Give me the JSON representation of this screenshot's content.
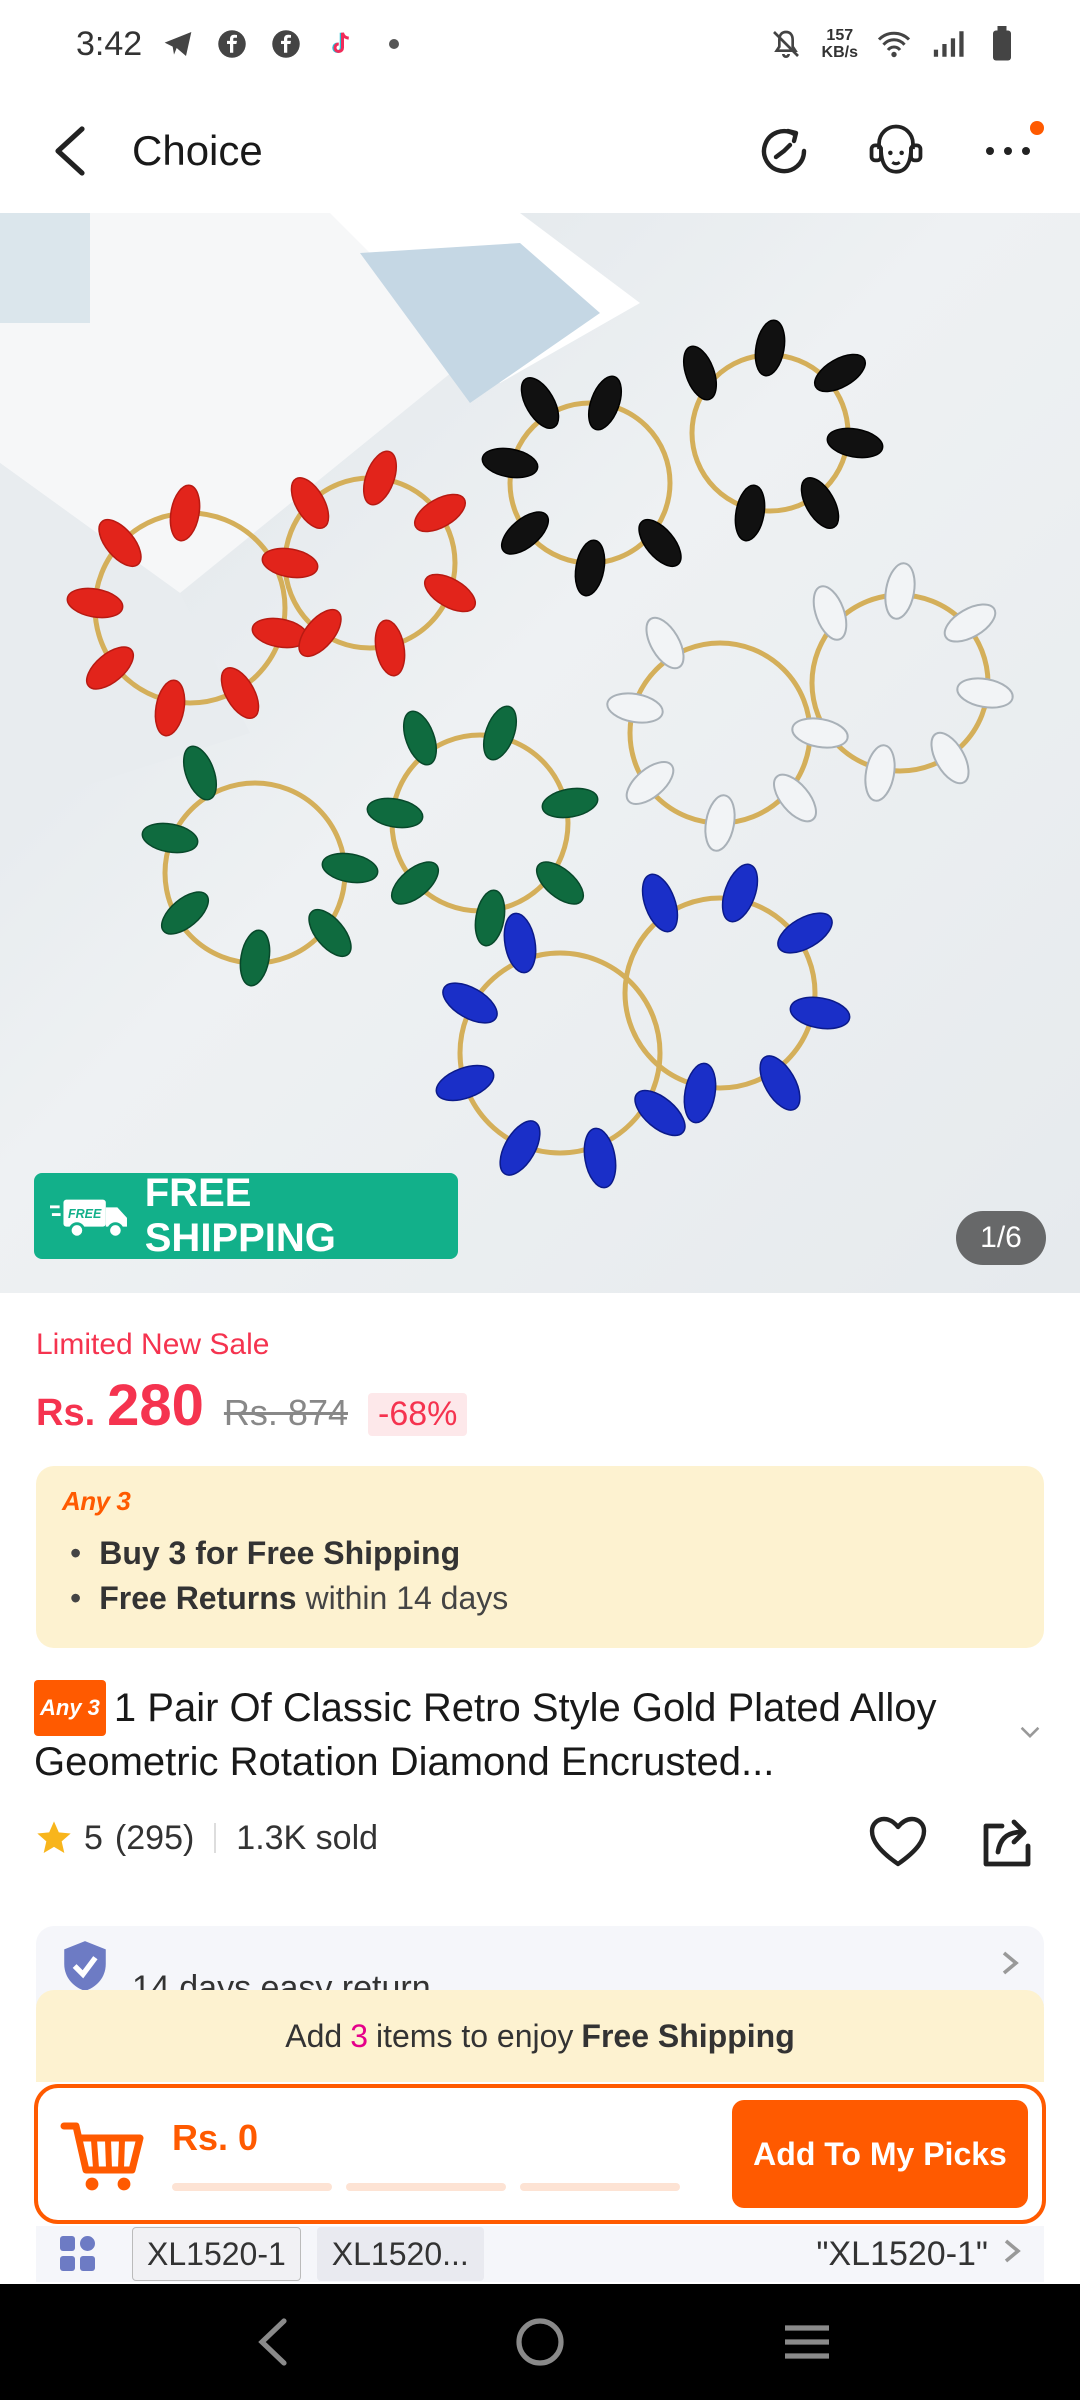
{
  "status_bar": {
    "time": "3:42",
    "net_speed": "157",
    "net_unit": "KB/s"
  },
  "header": {
    "title": "Choice"
  },
  "gallery": {
    "free_shipping_label": "FREE SHIPPING",
    "badge_text": "FREE",
    "counter": "1/6"
  },
  "price": {
    "promo_label": "Limited New Sale",
    "currency": "Rs.",
    "current": "280",
    "original": "Rs. 874",
    "discount": "-68%"
  },
  "any3": {
    "tag": "Any 3",
    "line1_bold": "Buy 3 for  Free Shipping",
    "line2_bold": "Free Returns",
    "line2_rest": " within 14 days"
  },
  "product": {
    "tag": "Any 3",
    "title": "1 Pair Of Classic Retro Style Gold Plated Alloy Geometric Rotation Diamond Encrusted..."
  },
  "rating": {
    "score": "5",
    "reviews": "(295)",
    "sold": "1.3K sold"
  },
  "service": {
    "return_text": "14 days easy return"
  },
  "ship_banner": {
    "prefix": "Add",
    "count": "3",
    "middle": "items to enjoy",
    "bold": "Free Shipping"
  },
  "cart": {
    "total": "Rs. 0",
    "button": "Add To My Picks"
  },
  "variants": {
    "chip1": "XL1520-1",
    "chip2": "XL1520...",
    "selected": "\"XL1520-1\""
  },
  "colors": {
    "accent": "#ff5a00",
    "price_red": "#f5334f",
    "free_green": "#12b08a",
    "promo_bg": "#fdf2d0"
  },
  "icons": [
    "back-icon",
    "history-icon",
    "support-agent-icon",
    "more-icon",
    "truck-icon",
    "star-icon",
    "heart-icon",
    "share-icon",
    "shield-icon",
    "cart-icon",
    "grid-icon",
    "nav-back-icon",
    "nav-home-icon",
    "nav-recents-icon"
  ]
}
